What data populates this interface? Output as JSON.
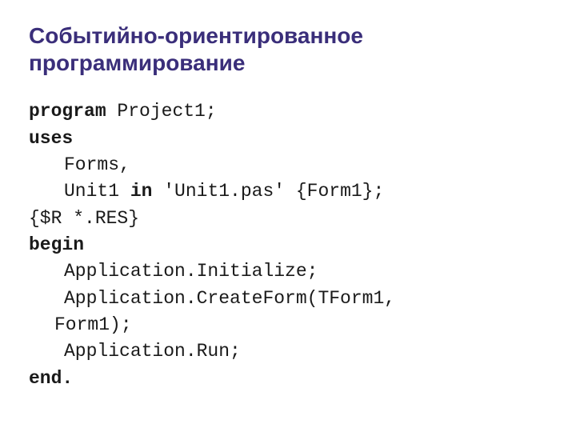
{
  "title": "Событийно-ориентированное программирование",
  "code": {
    "l1": {
      "kw": "program",
      "rest": " Project1;"
    },
    "l2": {
      "kw": "uses"
    },
    "l3": {
      "text": "Forms,"
    },
    "l4": {
      "pre": "Unit1 ",
      "kw": "in",
      "post": " 'Unit1.pas' {Form1};"
    },
    "l5": {
      "text": "{$R *.RES}"
    },
    "l6": {
      "kw": "begin"
    },
    "l7": {
      "text": "Application.Initialize;"
    },
    "l8": {
      "text": "Application.CreateForm(TForm1,"
    },
    "l8cont": {
      "text": "Form1);"
    },
    "l9": {
      "text": "Application.Run;"
    },
    "l10": {
      "kw": "end."
    }
  }
}
